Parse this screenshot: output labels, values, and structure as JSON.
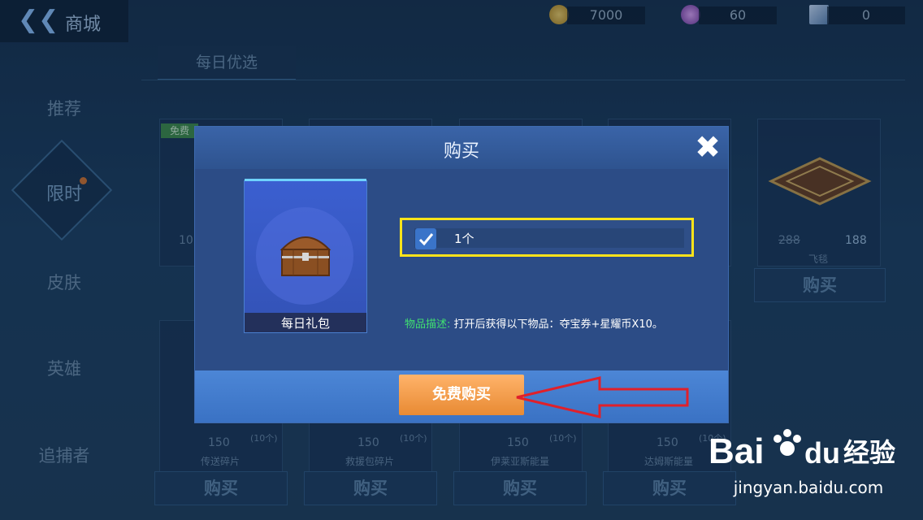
{
  "header": {
    "back_label": "商城"
  },
  "currency": {
    "gold": "7000",
    "gem": "60",
    "ticket": "0"
  },
  "sidebar": {
    "items": [
      {
        "label": "推荐"
      },
      {
        "label": "限时"
      },
      {
        "label": "皮肤"
      },
      {
        "label": "英雄"
      },
      {
        "label": "追捕者"
      }
    ]
  },
  "tabs": [
    {
      "label": "每日优选"
    }
  ],
  "shop": {
    "free_badge": "免费",
    "buy_label": "购买",
    "price_top": [
      "10",
      "288",
      "188"
    ],
    "top_item_name": "飞毯",
    "bottom_items": [
      {
        "name": "传送碎片",
        "price": "150",
        "count": "(10个)"
      },
      {
        "name": "救援包碎片",
        "price": "150",
        "count": "(10个)"
      },
      {
        "name": "伊莱亚斯能量",
        "price": "150",
        "count": "(10个)"
      },
      {
        "name": "达姆斯能量",
        "price": "150",
        "count": "(10个)"
      }
    ]
  },
  "modal": {
    "title": "购买",
    "close_icon": "close-icon",
    "item_name": "每日礼包",
    "quantity_text": "1个",
    "desc_label": "物品描述:",
    "desc_text": "打开后获得以下物品：夺宝券+星耀币X10。",
    "confirm_label": "免费购买"
  },
  "watermark": {
    "text": "jingyan.baidu.com",
    "brand": "Bai",
    "brand2": "经验"
  },
  "colors": {
    "highlight": "#ffe31a",
    "arrow": "#e0202a",
    "accent": "#e88a33",
    "desc_label": "#40e070"
  }
}
